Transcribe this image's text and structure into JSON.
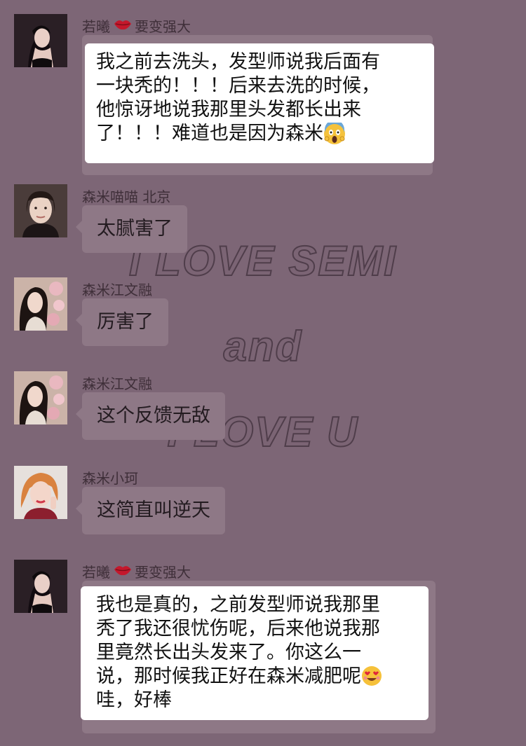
{
  "watermark": {
    "line1": "I LOVE SEMI",
    "line2": "and",
    "line3": "I LOVE U"
  },
  "messages": [
    {
      "sender": "若曦",
      "sender_suffix": "要变强大",
      "lines": [
        "我之前去洗头，发型师说我后面有",
        "一块秃的！！！后来去洗的时候，",
        "他惊讶地说我那里头发都长出来",
        "了！！！难道也是因为森米"
      ]
    },
    {
      "sender": "森米喵喵 北京",
      "text": "太腻害了"
    },
    {
      "sender": "森米江文融",
      "text": "厉害了"
    },
    {
      "sender": "森米江文融",
      "text": "这个反馈无敌"
    },
    {
      "sender": "森米小珂",
      "text": "这简直叫逆天"
    },
    {
      "sender": "若曦",
      "sender_suffix": "要变强大",
      "lines": [
        "我也是真的，之前发型师说我那里",
        "秃了我还很忧伤呢，后来他说我那",
        "里竟然长出头发来了。你这么一",
        "说，那时候我正好在森米减肥呢",
        "哇，好棒"
      ]
    }
  ],
  "icons": [
    "kiss-lips-icon",
    "scream-face-emoji",
    "heart-eyes-emoji"
  ],
  "colors": {
    "background": "#7d6676",
    "bubble": "#8e7886",
    "card": "#ffffff",
    "lips": "#c4182c"
  }
}
